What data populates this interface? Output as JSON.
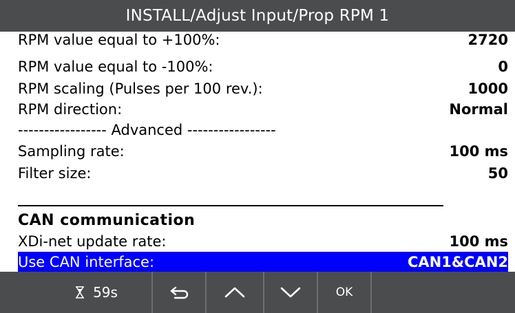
{
  "title": "INSTALL/Adjust Input/Prop RPM 1",
  "rows": {
    "cut": {
      "label": "RPM value equal to +100%:",
      "value": "2720"
    },
    "rpm_minus": {
      "label": "RPM value equal to -100%:",
      "value": "0"
    },
    "rpm_scaling": {
      "label": "RPM scaling (Pulses per 100 rev.):",
      "value": "1000"
    },
    "rpm_direction": {
      "label": "RPM direction:",
      "value": "Normal"
    },
    "advanced_header": "----------------- Advanced -----------------",
    "sampling_rate": {
      "label": "Sampling rate:",
      "value": "100 ms"
    },
    "filter_size": {
      "label": "Filter size:",
      "value": "50"
    },
    "can_section": "CAN communication",
    "xdi_rate": {
      "label": "XDi-net update rate:",
      "value": "100 ms"
    },
    "use_can": {
      "label": "Use CAN interface:",
      "value": "CAN1&CAN2"
    }
  },
  "toolbar": {
    "timer": "59s",
    "ok_label": "OK",
    "icons": {
      "timer": "hourglass-icon",
      "back": "back-arrow-icon",
      "up": "chevron-up-icon",
      "down": "chevron-down-icon"
    }
  },
  "colors": {
    "bar_background": "#4a4c4e",
    "selection": "#0000ff",
    "text": "#000000",
    "bar_text": "#ffffff"
  }
}
